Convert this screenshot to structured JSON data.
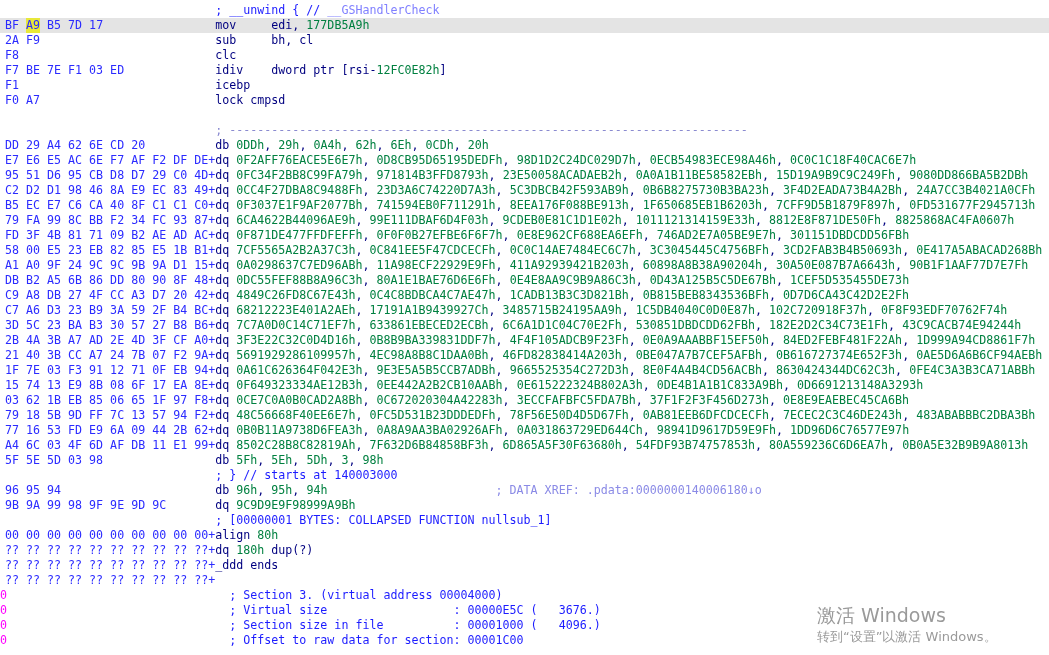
{
  "rows": [
    {
      "kind": "comment",
      "selected": false,
      "comment": "; __unwind { //",
      "comment_ref": "__GSHandlerCheck"
    },
    {
      "kind": "instr",
      "selected": true,
      "bytes": [
        {
          "text": "BF ",
          "selected": false
        },
        {
          "text": "A9",
          "selected": true
        },
        {
          "text": " B5 7D 17",
          "selected": false
        }
      ],
      "mnemonic": "mov",
      "operands": "edi, 177DB5A9h"
    },
    {
      "kind": "instr",
      "selected": false,
      "bytes": [
        {
          "text": "2A F9",
          "selected": false
        }
      ],
      "mnemonic": "sub",
      "operands": "bh, cl"
    },
    {
      "kind": "instr",
      "selected": false,
      "bytes": [
        {
          "text": "F8",
          "selected": false
        }
      ],
      "mnemonic": "clc"
    },
    {
      "kind": "instr",
      "selected": false,
      "bytes": [
        {
          "text": "F7 BE 7E F1 03 ED",
          "selected": false
        }
      ],
      "mnemonic": "idiv",
      "operands": "dword ptr [rsi-12FC0E82h]"
    },
    {
      "kind": "instr",
      "selected": false,
      "bytes": [
        {
          "text": "F1",
          "selected": false
        }
      ],
      "mnemonic": "icebp"
    },
    {
      "kind": "instr",
      "selected": false,
      "bytes": [
        {
          "text": "F0 A7",
          "selected": false
        }
      ],
      "mnemonic": "lock cmpsd"
    },
    {
      "kind": "blank",
      "selected": false
    },
    {
      "kind": "separator",
      "selected": false,
      "comment": "; --------------------------------------------------------------------------"
    },
    {
      "kind": "data",
      "selected": false,
      "bytes": [
        {
          "text": "DD 29 A4 62 6E CD 20",
          "selected": false
        }
      ],
      "mnemonic": "db",
      "operands": "0DDh, 29h, 0A4h, 62h, 6Eh, 0CDh, 20h"
    },
    {
      "kind": "data",
      "selected": false,
      "bytes": [
        {
          "text": "E7 E6 E5 AC 6E F7 AF F2 DF DE+",
          "selected": false
        }
      ],
      "mnemonic": "dq",
      "operands": "0F2AFF76EACE5E6E7h, 0D8CB95D65195DEDFh, 98D1D2C24DC029D7h, 0ECB54983ECE98A46h, 0C0C1C18F40CAC6E7h"
    },
    {
      "kind": "data",
      "selected": false,
      "bytes": [
        {
          "text": "95 51 D6 95 CB D8 D7 29 C0 4D+",
          "selected": false
        }
      ],
      "mnemonic": "dq",
      "operands": "0FC34F2BB8C99FA79h, 971814B3FFD8793h, 23E50058ACADAEB2h, 0A0A1B11BE58582EBh, 15D19A9B9C9C249Fh, 9080DD866BA5B2DBh"
    },
    {
      "kind": "data",
      "selected": false,
      "bytes": [
        {
          "text": "C2 D2 D1 98 46 8A E9 EC 83 49+",
          "selected": false
        }
      ],
      "mnemonic": "dq",
      "operands": "0CC4F27DBA8C9488Fh, 23D3A6C74220D7A3h, 5C3DBCB42F593AB9h, 0B6B8275730B3BA23h, 3F4D2EADA73B4A2Bh, 24A7CC3B4021A0CFh"
    },
    {
      "kind": "data",
      "selected": false,
      "bytes": [
        {
          "text": "B5 EC E7 C6 CA 40 8F C1 C1 C0+",
          "selected": false
        }
      ],
      "mnemonic": "dq",
      "operands": "0F3037E1F9AF2077Bh, 741594EB0F711291h, 8EEA176F088BE913h, 1F650685EB1B6203h, 7CFF9D5B1879F897h, 0FD531677F2945713h"
    },
    {
      "kind": "data",
      "selected": false,
      "bytes": [
        {
          "text": "79 FA 99 8C BB F2 34 FC 93 87+",
          "selected": false
        }
      ],
      "mnemonic": "dq",
      "operands": "6CA4622B44096AE9h, 99E111DBAF6D4F03h, 9CDEB0E81C1D1E02h, 1011121314159E33h, 8812E8F871DE50Fh, 8825868AC4FA0607h"
    },
    {
      "kind": "data",
      "selected": false,
      "bytes": [
        {
          "text": "FD 3F 4B 81 71 09 B2 AE AD AC+",
          "selected": false
        }
      ],
      "mnemonic": "dq",
      "operands": "0F871DE477FFDFEFFh, 0F0F0B27EFBE6F6F7h, 0E8E962CF688EA6EFh, 746AD2E7A05BE9E7h, 301151DBDCDD56FBh"
    },
    {
      "kind": "data",
      "selected": false,
      "bytes": [
        {
          "text": "58 00 E5 23 EB 82 85 E5 1B B1+",
          "selected": false
        }
      ],
      "mnemonic": "dq",
      "operands": "7CF5565A2B2A37C3h, 0C841EE5F47CDCECFh, 0C0C14AE7484EC6C7h, 3C3045445C4756BFh, 3CD2FAB3B4B50693h, 0E417A5ABACAD268Bh"
    },
    {
      "kind": "data",
      "selected": false,
      "bytes": [
        {
          "text": "A1 A0 9F 24 9C 9C 9B 9A D1 15+",
          "selected": false
        }
      ],
      "mnemonic": "dq",
      "operands": "0A0298637C7ED96ABh, 11A98ECF22929E9Fh, 411A92939421B203h, 60898A8B38A90204h, 30A50E087B7A6643h, 90B1F1AAF77D7E7Fh"
    },
    {
      "kind": "data",
      "selected": false,
      "bytes": [
        {
          "text": "DB B2 A5 6B 86 DD 80 90 8F 48+",
          "selected": false
        }
      ],
      "mnemonic": "dq",
      "operands": "0DC55FEF88B8A96C3h, 80A1E1BAE76D6E6Fh, 0E4E8AA9C9B9A86C3h, 0D43A125B5C5DE67Bh, 1CEF5D535455DE73h"
    },
    {
      "kind": "data",
      "selected": false,
      "bytes": [
        {
          "text": "C9 A8 DB 27 4F CC A3 D7 20 42+",
          "selected": false
        }
      ],
      "mnemonic": "dq",
      "operands": "4849C26FD8C67E43h, 0C4C8BDBCA4C7AE47h, 1CADB13B3C3D821Bh, 0B815BEB8343536BFh, 0D7D6CA43C42D2E2Fh"
    },
    {
      "kind": "data",
      "selected": false,
      "bytes": [
        {
          "text": "C7 A6 D3 23 B9 3A 59 2F B4 BC+",
          "selected": false
        }
      ],
      "mnemonic": "dq",
      "operands": "68212223E401A2AEh, 17191A1B9439927Ch, 3485715B24195AA9h, 1C5DB4040C0D0E87h, 102C720918F37h, 0F8F93EDF70762F74h"
    },
    {
      "kind": "data",
      "selected": false,
      "bytes": [
        {
          "text": "3D 5C 23 BA B3 30 57 27 B8 B6+",
          "selected": false
        }
      ],
      "mnemonic": "dq",
      "operands": "7C7A0D0C14C71EF7h, 633861EBECED2ECBh, 6C6A1D1C04C70E2Fh, 530851DBDCDD62FBh, 182E2D2C34C73E1Fh, 43C9CACB74E94244h"
    },
    {
      "kind": "data",
      "selected": false,
      "bytes": [
        {
          "text": "2B 4A 3B A7 AD 2E 4D 3F CF A0+",
          "selected": false
        }
      ],
      "mnemonic": "dq",
      "operands": "3F3E22C32C0D4D16h, 0B8B9BA339831DDF7h, 4F4F105ADCB9F23Fh, 0E0A9AAABBF15EF50h, 84ED2FEBF481F22Ah, 1D999A94CD8861F7h"
    },
    {
      "kind": "data",
      "selected": false,
      "bytes": [
        {
          "text": "21 40 3B CC A7 24 7B 07 F2 9A+",
          "selected": false
        }
      ],
      "mnemonic": "dq",
      "operands": "5691929286109957h, 4EC98A8B8C1DAA0Bh, 46FD82838414A203h, 0BE047A7B7CEF5AFBh, 0B616727374E652F3h, 0AE5D6A6B6CF94AEBh"
    },
    {
      "kind": "data",
      "selected": false,
      "bytes": [
        {
          "text": "1F 7E 03 F3 91 12 71 0F EB 94+",
          "selected": false
        }
      ],
      "mnemonic": "dq",
      "operands": "0A61C626364F042E3h, 9E3E5A5B5CCB7ADBh, 9665525354C272D3h, 8E0F4A4B4CD56ACBh, 8630424344DC62C3h, 0FE4C3A3B3CA71ABBh"
    },
    {
      "kind": "data",
      "selected": false,
      "bytes": [
        {
          "text": "15 74 13 E9 8B 08 6F 17 EA 8E+",
          "selected": false
        }
      ],
      "mnemonic": "dq",
      "operands": "0F649323334AE12B3h, 0EE442A2B2CB10AABh, 0E615222324B802A3h, 0DE4B1A1B1C833A9Bh, 0D6691213148A3293h"
    },
    {
      "kind": "data",
      "selected": false,
      "bytes": [
        {
          "text": "03 62 1B EB 85 06 65 1F 97 F8+",
          "selected": false
        }
      ],
      "mnemonic": "dq",
      "operands": "0CE7C0A0B0CAD2A8Bh, 0C672020304A42283h, 3ECCFAFBFC5FDA7Bh, 37F1F2F3F456D273h, 0E8E9EAEBEC45CA6Bh"
    },
    {
      "kind": "data",
      "selected": false,
      "bytes": [
        {
          "text": "79 18 5B 9D FF 7C 13 57 94 F2+",
          "selected": false
        }
      ],
      "mnemonic": "dq",
      "operands": "48C56668F40EE6E7h, 0FC5D531B23DDDEDFh, 78F56E50D4D5D67Fh, 0AB81EEB6DFCDCECFh, 7ECEC2C3C46DE243h, 483ABABBBC2DBA3Bh"
    },
    {
      "kind": "data",
      "selected": false,
      "bytes": [
        {
          "text": "77 16 53 FD E9 6A 09 44 2B 62+",
          "selected": false
        }
      ],
      "mnemonic": "dq",
      "operands": "0B0B11A9738D6FEA3h, 0A8A9AA3BA02926AFh, 0A031863729ED644Ch, 98941D9617D59E9Fh, 1DD96D6C76577E97h"
    },
    {
      "kind": "data",
      "selected": false,
      "bytes": [
        {
          "text": "A4 6C 03 4F 6D AF DB 11 E1 99+",
          "selected": false
        }
      ],
      "mnemonic": "dq",
      "operands": "8502C28B8C82819Ah, 7F632D6B84858BF3h, 6D865A5F30F63680h, 54FDF93B74757853h, 80A559236C6D6EA7h, 0B0A5E32B9B9A8013h"
    },
    {
      "kind": "data",
      "selected": false,
      "bytes": [
        {
          "text": "5F 5E 5D 03 98",
          "selected": false
        }
      ],
      "mnemonic": "db",
      "operands": "5Fh, 5Eh, 5Dh, 3, 98h"
    },
    {
      "kind": "comment",
      "selected": false,
      "comment": "; } // starts at 140003000"
    },
    {
      "kind": "data",
      "selected": false,
      "bytes": [
        {
          "text": "96 95 94",
          "selected": false
        }
      ],
      "mnemonic": "db",
      "operands": "96h, 95h, 94h",
      "xref": "; DATA XREF: .pdata:0000000140006180↓o"
    },
    {
      "kind": "data",
      "selected": false,
      "bytes": [
        {
          "text": "9B 9A 99 98 9F 9E 9D 9C",
          "selected": false
        }
      ],
      "mnemonic": "dq",
      "operands": "9C9D9E9F98999A9Bh"
    },
    {
      "kind": "comment",
      "selected": false,
      "comment": "; [00000001 BYTES: COLLAPSED FUNCTION nullsub_1]"
    },
    {
      "kind": "inline",
      "selected": false,
      "bytes": [
        {
          "text": "00 00 00 00 00 00 00 00 00 00+",
          "selected": false
        }
      ],
      "mnemonic": "align",
      "operands": "80h"
    },
    {
      "kind": "inline",
      "selected": false,
      "bytes": [
        {
          "text": "?? ?? ?? ?? ?? ?? ?? ?? ?? ??+",
          "selected": false
        }
      ],
      "mnemonic": "dq",
      "operands": "180h dup(?)"
    },
    {
      "kind": "inline",
      "selected": false,
      "bytes": [
        {
          "text": "?? ?? ?? ?? ?? ?? ?? ?? ?? ??+",
          "selected": false
        }
      ],
      "mnemonic": "_ddd ends"
    },
    {
      "kind": "inline",
      "selected": false,
      "bytes": [
        {
          "text": "?? ?? ?? ?? ?? ?? ?? ?? ?? ??+",
          "selected": false
        }
      ]
    },
    {
      "kind": "section",
      "selected": false,
      "bytes": [
        {
          "text": "0",
          "selected": false
        }
      ],
      "comment": "; Section 3. (virtual address 00004000)"
    },
    {
      "kind": "section",
      "selected": false,
      "bytes": [
        {
          "text": "0",
          "selected": false
        }
      ],
      "comment": "; Virtual size                  : 00000E5C (   3676.)"
    },
    {
      "kind": "section",
      "selected": false,
      "bytes": [
        {
          "text": "0",
          "selected": false
        }
      ],
      "comment": "; Section size in file          : 00001000 (   4096.)"
    },
    {
      "kind": "section",
      "selected": false,
      "bytes": [
        {
          "text": "0",
          "selected": false
        }
      ],
      "comment": "; Offset to raw data for section: 00001C00"
    }
  ],
  "activation_notice": {
    "title": "激活 Windows",
    "message": "转到“设置”以激活 Windows。"
  }
}
